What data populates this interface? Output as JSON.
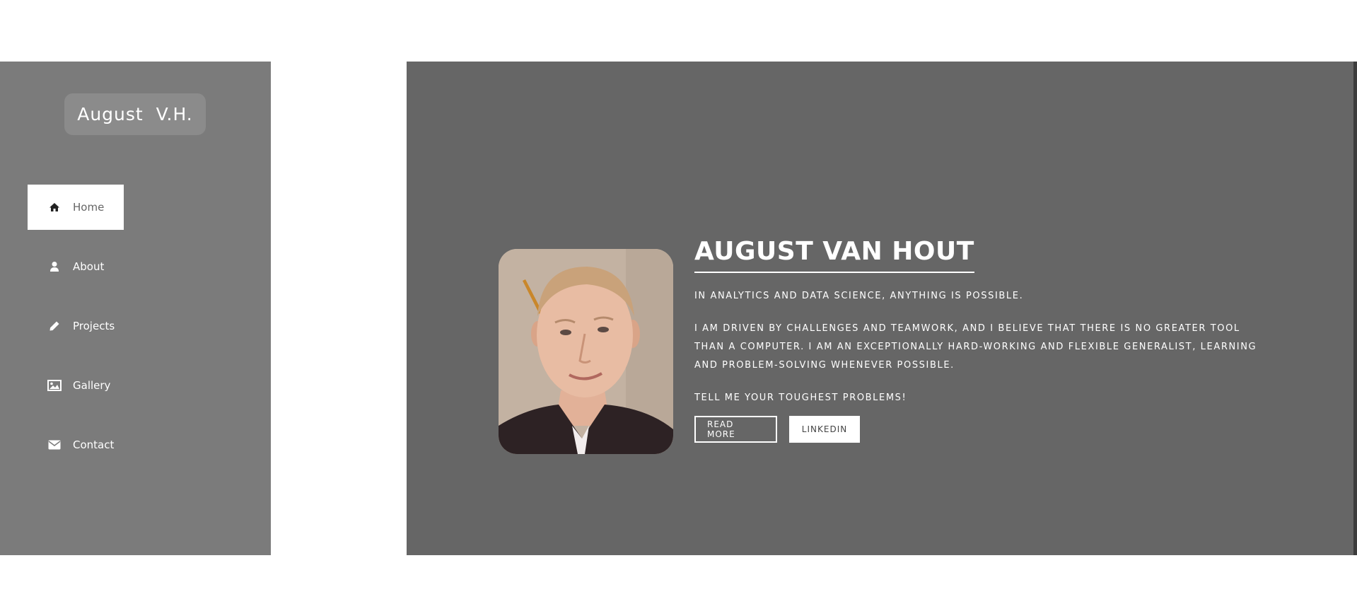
{
  "sidebar": {
    "logo": "August  V.H.",
    "items": [
      {
        "label": "Home",
        "icon": "home-icon",
        "active": true
      },
      {
        "label": "About",
        "icon": "user-icon",
        "active": false
      },
      {
        "label": "Projects",
        "icon": "pencil-icon",
        "active": false
      },
      {
        "label": "Gallery",
        "icon": "image-icon",
        "active": false
      },
      {
        "label": "Contact",
        "icon": "envelope-icon",
        "active": false
      }
    ]
  },
  "hero": {
    "name": "AUGUST VAN HOUT",
    "tagline": "IN ANALYTICS AND DATA SCIENCE, ANYTHING IS POSSIBLE.",
    "paragraph": "I AM DRIVEN BY CHALLENGES AND TEAMWORK, AND I BELIEVE THAT THERE IS NO GREATER TOOL THAN A COMPUTER. I AM AN EXCEPTIONALLY HARD-WORKING AND FLEXIBLE GENERALIST, LEARNING AND PROBLEM-SOLVING WHENEVER POSSIBLE.",
    "cta": "TELL ME YOUR TOUGHEST PROBLEMS!",
    "read_more": "READ MORE",
    "linkedin": "LINKEDIN"
  },
  "colors": {
    "sidebar_bg": "#7b7b7b",
    "hero_bg": "#666666",
    "accent": "#ffffff"
  }
}
